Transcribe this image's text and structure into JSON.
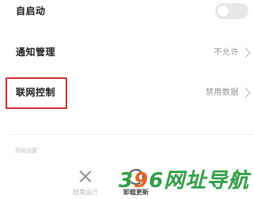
{
  "settings": {
    "autostart": {
      "label": "自启动",
      "enabled": false
    },
    "notification": {
      "label": "通知管理",
      "value": "不允许"
    },
    "network": {
      "label": "联网控制",
      "value": "禁用数据"
    }
  },
  "section": {
    "label": "高级设置"
  },
  "actions": {
    "stop": {
      "label": "结束运行"
    },
    "uninstall": {
      "label": "卸载更新"
    }
  },
  "watermark": {
    "text_parts": [
      "396",
      "网址导航"
    ],
    "colors": [
      "#2f9d44",
      "#e2612b",
      "#2f9d44"
    ]
  },
  "colors": {
    "highlight_border": "#cf2d2d",
    "toggle_off": "#e7e7e7"
  }
}
